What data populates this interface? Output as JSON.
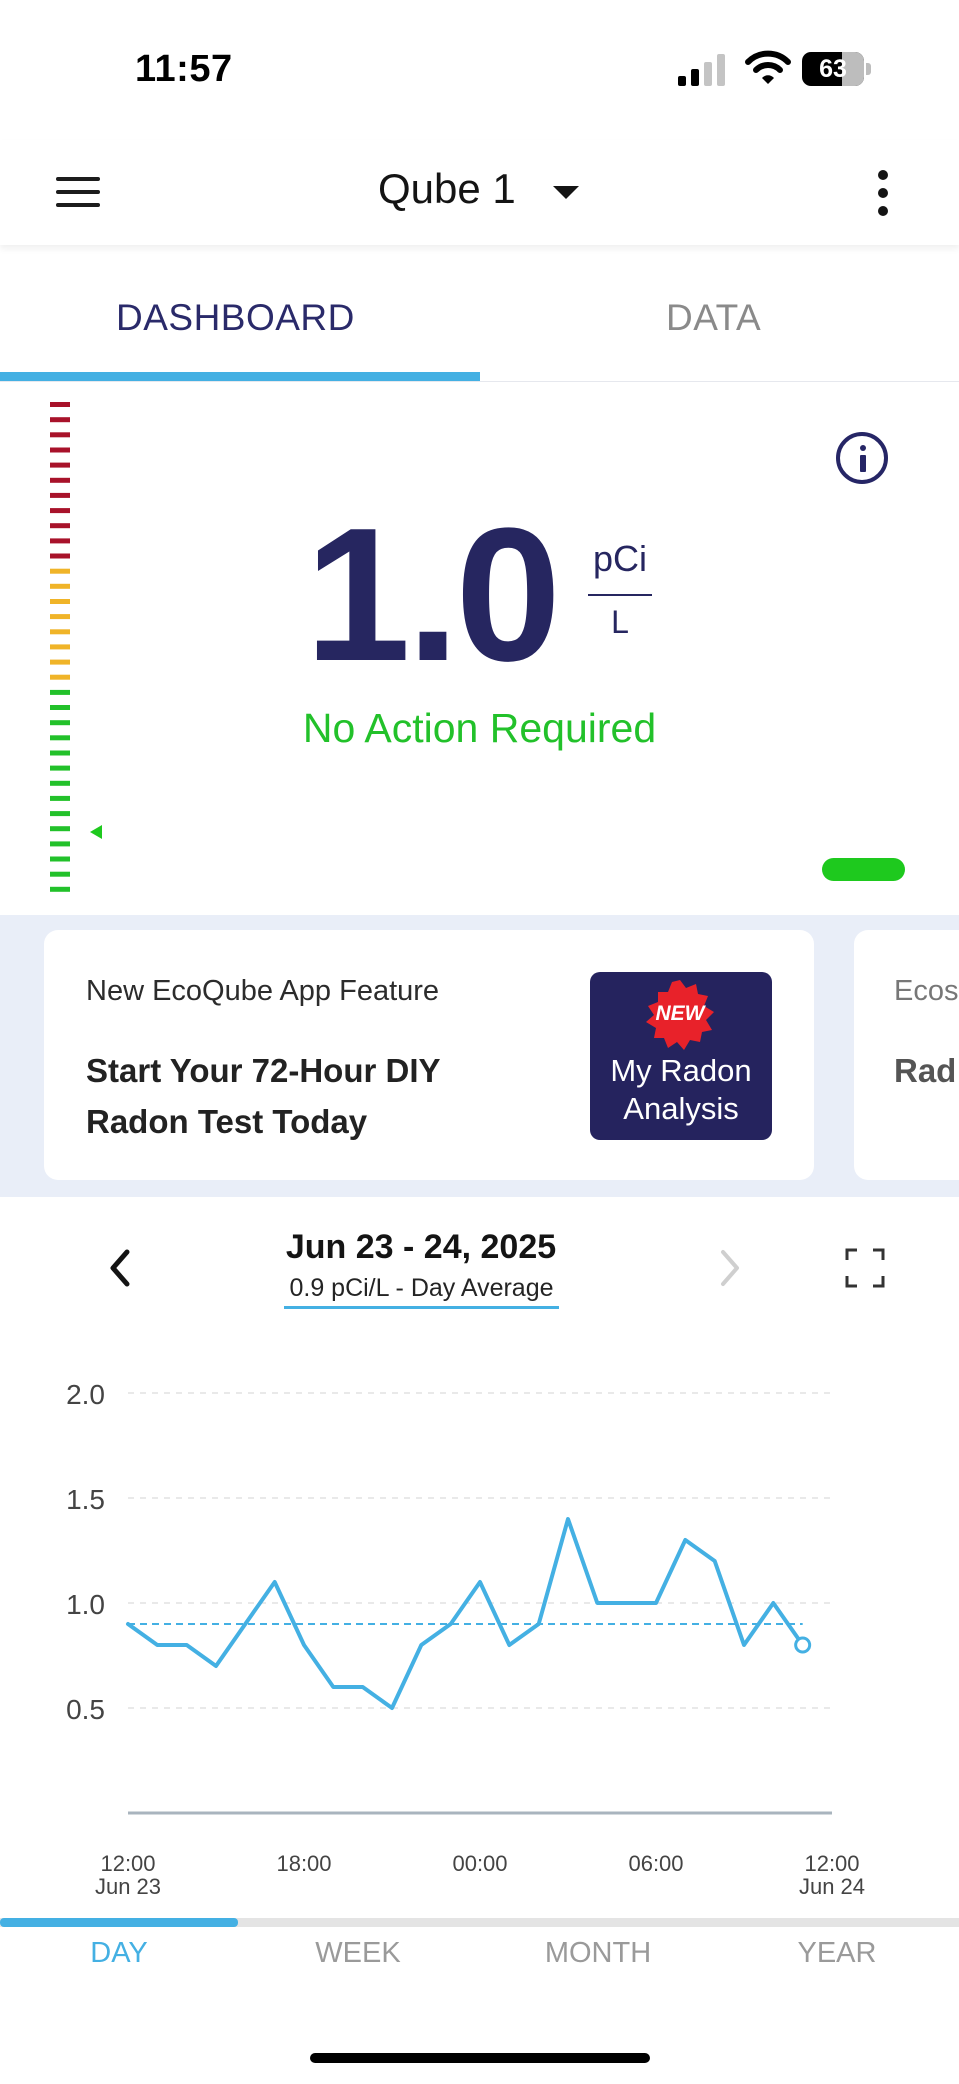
{
  "status_bar": {
    "time": "11:57",
    "battery": "63"
  },
  "header": {
    "title": "Qube 1"
  },
  "tabs": [
    {
      "label": "DASHBOARD",
      "active": true
    },
    {
      "label": "DATA",
      "active": false
    }
  ],
  "reading": {
    "value": "1.0",
    "unit_top": "pCi",
    "unit_bottom": "L",
    "status": "No Action Required",
    "status_color": "#22c12a"
  },
  "promo": {
    "kicker": "New EcoQube App Feature",
    "headline": "Start Your 72-Hour DIY Radon Test Today",
    "badge_new": "NEW",
    "badge_label": "My Radon Analysis",
    "next_kicker": "Ecos",
    "next_headline": "Rad hea"
  },
  "chart_header": {
    "date_range": "Jun 23 - 24, 2025",
    "average": "0.9 pCi/L - Day Average"
  },
  "chart_data": {
    "type": "line",
    "y_ticks": [
      "2.0",
      "1.5",
      "1.0",
      "0.5"
    ],
    "ylim": [
      0,
      2.0
    ],
    "x_ticks": [
      {
        "time": "12:00",
        "date": "Jun 23"
      },
      {
        "time": "18:00",
        "date": ""
      },
      {
        "time": "00:00",
        "date": ""
      },
      {
        "time": "06:00",
        "date": ""
      },
      {
        "time": "12:00",
        "date": "Jun 24"
      }
    ],
    "x_hours": [
      0,
      1,
      2,
      3,
      4,
      5,
      6,
      7,
      8,
      9,
      10,
      11,
      12,
      13,
      14,
      15,
      16,
      17,
      18,
      19,
      20,
      21,
      22,
      23
    ],
    "values": [
      0.9,
      0.8,
      0.8,
      0.7,
      0.9,
      1.1,
      0.8,
      0.6,
      0.6,
      0.5,
      0.8,
      0.9,
      1.1,
      0.8,
      0.9,
      1.4,
      1.0,
      1.0,
      1.0,
      1.3,
      1.2,
      0.8,
      1.0,
      0.8
    ],
    "average": 0.9,
    "line_color": "#44b0e3"
  },
  "range_tabs": [
    "DAY",
    "WEEK",
    "MONTH",
    "YEAR"
  ]
}
